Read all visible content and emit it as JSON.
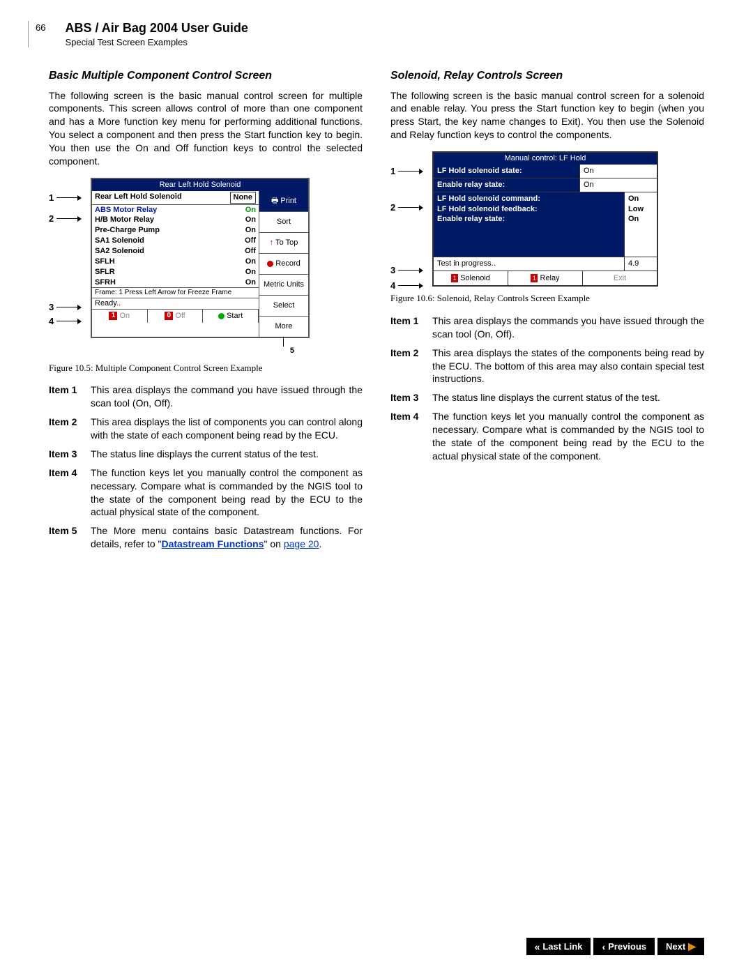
{
  "page_number": "66",
  "header_title": "ABS / Air Bag 2004 User Guide",
  "header_sub": "Special Test Screen Examples",
  "left": {
    "heading": "Basic Multiple Component Control Screen",
    "intro": "The following screen is the basic manual control screen for multiple components. This screen allows control of more than one component and has a More function key menu for performing additional functions. You select a component and then press the Start function key to begin. You then use the On and Off function keys to control the selected component.",
    "fig": {
      "title_bar": "Rear Left Hold Solenoid",
      "cmd_label": "Rear Left Hold Solenoid",
      "cmd_value": "None",
      "comps": [
        {
          "name": "ABS Motor Relay",
          "val": "On"
        },
        {
          "name": "H/B Motor Relay",
          "val": "On"
        },
        {
          "name": "Pre-Charge Pump",
          "val": "On"
        },
        {
          "name": "SA1 Solenoid",
          "val": "Off"
        },
        {
          "name": "SA2 Solenoid",
          "val": "Off"
        },
        {
          "name": "SFLH",
          "val": "On"
        },
        {
          "name": "SFLR",
          "val": "On"
        },
        {
          "name": "SFRH",
          "val": "On"
        }
      ],
      "status_line": "Frame: 1       Press Left Arrow for Freeze Frame",
      "ready": "Ready..",
      "fn": {
        "on": "On",
        "off": "Off",
        "start": "Start"
      },
      "side": {
        "print": "Print",
        "sort": "Sort",
        "totop": "To Top",
        "record": "Record",
        "metric": "Metric Units",
        "select": "Select",
        "more": "More"
      }
    },
    "fig_cap": "Figure 10.5: Multiple Component Control Screen Example",
    "items": [
      {
        "label": "Item 1",
        "desc": "This area displays the command you have issued through the scan tool (On, Off)."
      },
      {
        "label": "Item 2",
        "desc": "This area displays the list of components you can control along with the state of each component being read by the ECU."
      },
      {
        "label": "Item 3",
        "desc": "The status line displays the current status of the test."
      },
      {
        "label": "Item 4",
        "desc": "The function keys let you manually control the component as necessary. Compare what is commanded by the NGIS tool to the state of the component being read by the ECU to the actual physical state of the component."
      },
      {
        "label": "Item 5",
        "desc_pre": "The More menu contains basic Datastream functions. For details, refer to \"",
        "link": "Datastream Functions",
        "desc_mid": "\" on ",
        "page_link": "page 20",
        "desc_post": "."
      }
    ]
  },
  "right": {
    "heading": "Solenoid, Relay Controls Screen",
    "intro": "The following screen is the basic manual control screen for a solenoid and enable relay. You press the Start function key to begin (when you press Start, the key name changes to Exit). You then use the Solenoid and Relay function keys to control the components.",
    "fig": {
      "title_bar": "Manual control: LF Hold",
      "r1l": "LF Hold solenoid state:",
      "r1r": "On",
      "r2l": "Enable relay state:",
      "r2r": "On",
      "blk_lines": [
        "LF Hold solenoid command:",
        "LF Hold solenoid feedback:",
        "Enable relay state:"
      ],
      "blk_vals": [
        "On",
        "Low",
        "On"
      ],
      "status": "Test in progress..",
      "status_val": "4.9",
      "fn": {
        "sol": "Solenoid",
        "rel": "Relay",
        "exit": "Exit"
      }
    },
    "fig_cap": "Figure 10.6: Solenoid, Relay Controls Screen Example",
    "items": [
      {
        "label": "Item 1",
        "desc": "This area displays the commands you have issued through the scan tool (On, Off)."
      },
      {
        "label": "Item 2",
        "desc": "This area displays the states of the components being read by the ECU. The bottom of this area may also contain special test instructions."
      },
      {
        "label": "Item 3",
        "desc": "The status line displays the current status of the test."
      },
      {
        "label": "Item 4",
        "desc": "The function keys let you manually control the component as necessary. Compare what is commanded by the NGIS tool to the state of the component being read by the ECU to the actual physical state of the component."
      }
    ]
  },
  "nav": {
    "last": "Last Link",
    "prev": "Previous",
    "next": "Next"
  }
}
